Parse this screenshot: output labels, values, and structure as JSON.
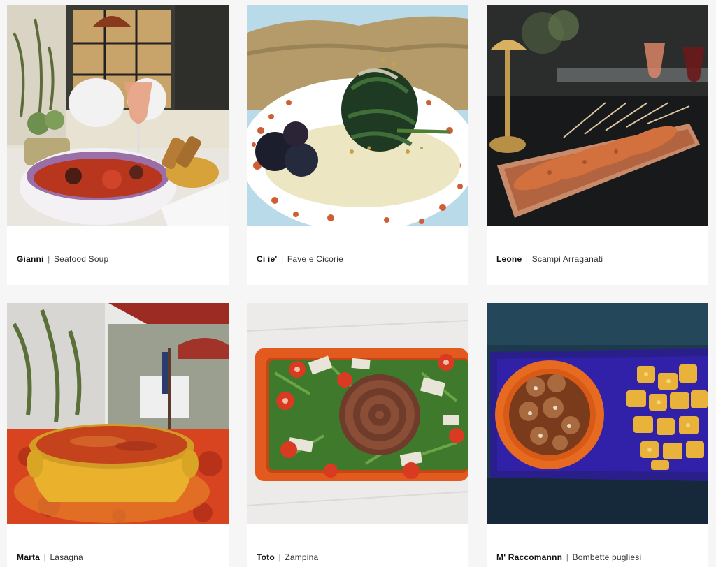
{
  "gallery": {
    "items": [
      {
        "name": "Gianni",
        "separator": "|",
        "dish": "Seafood Soup",
        "photo_icon": "seafood-soup-photo"
      },
      {
        "name": "Ci ie'",
        "separator": "|",
        "dish": "Fave e Cicorie",
        "photo_icon": "fave-cicorie-photo"
      },
      {
        "name": "Leone",
        "separator": "|",
        "dish": "Scampi Arraganati",
        "photo_icon": "scampi-photo"
      },
      {
        "name": "Marta",
        "separator": "|",
        "dish": "Lasagna",
        "photo_icon": "lasagna-photo"
      },
      {
        "name": "Toto",
        "separator": "|",
        "dish": "Zampina",
        "photo_icon": "zampina-photo"
      },
      {
        "name": "M' Raccomannn",
        "separator": "|",
        "dish": "Bombette pugliesi",
        "photo_icon": "bombette-photo"
      }
    ]
  }
}
